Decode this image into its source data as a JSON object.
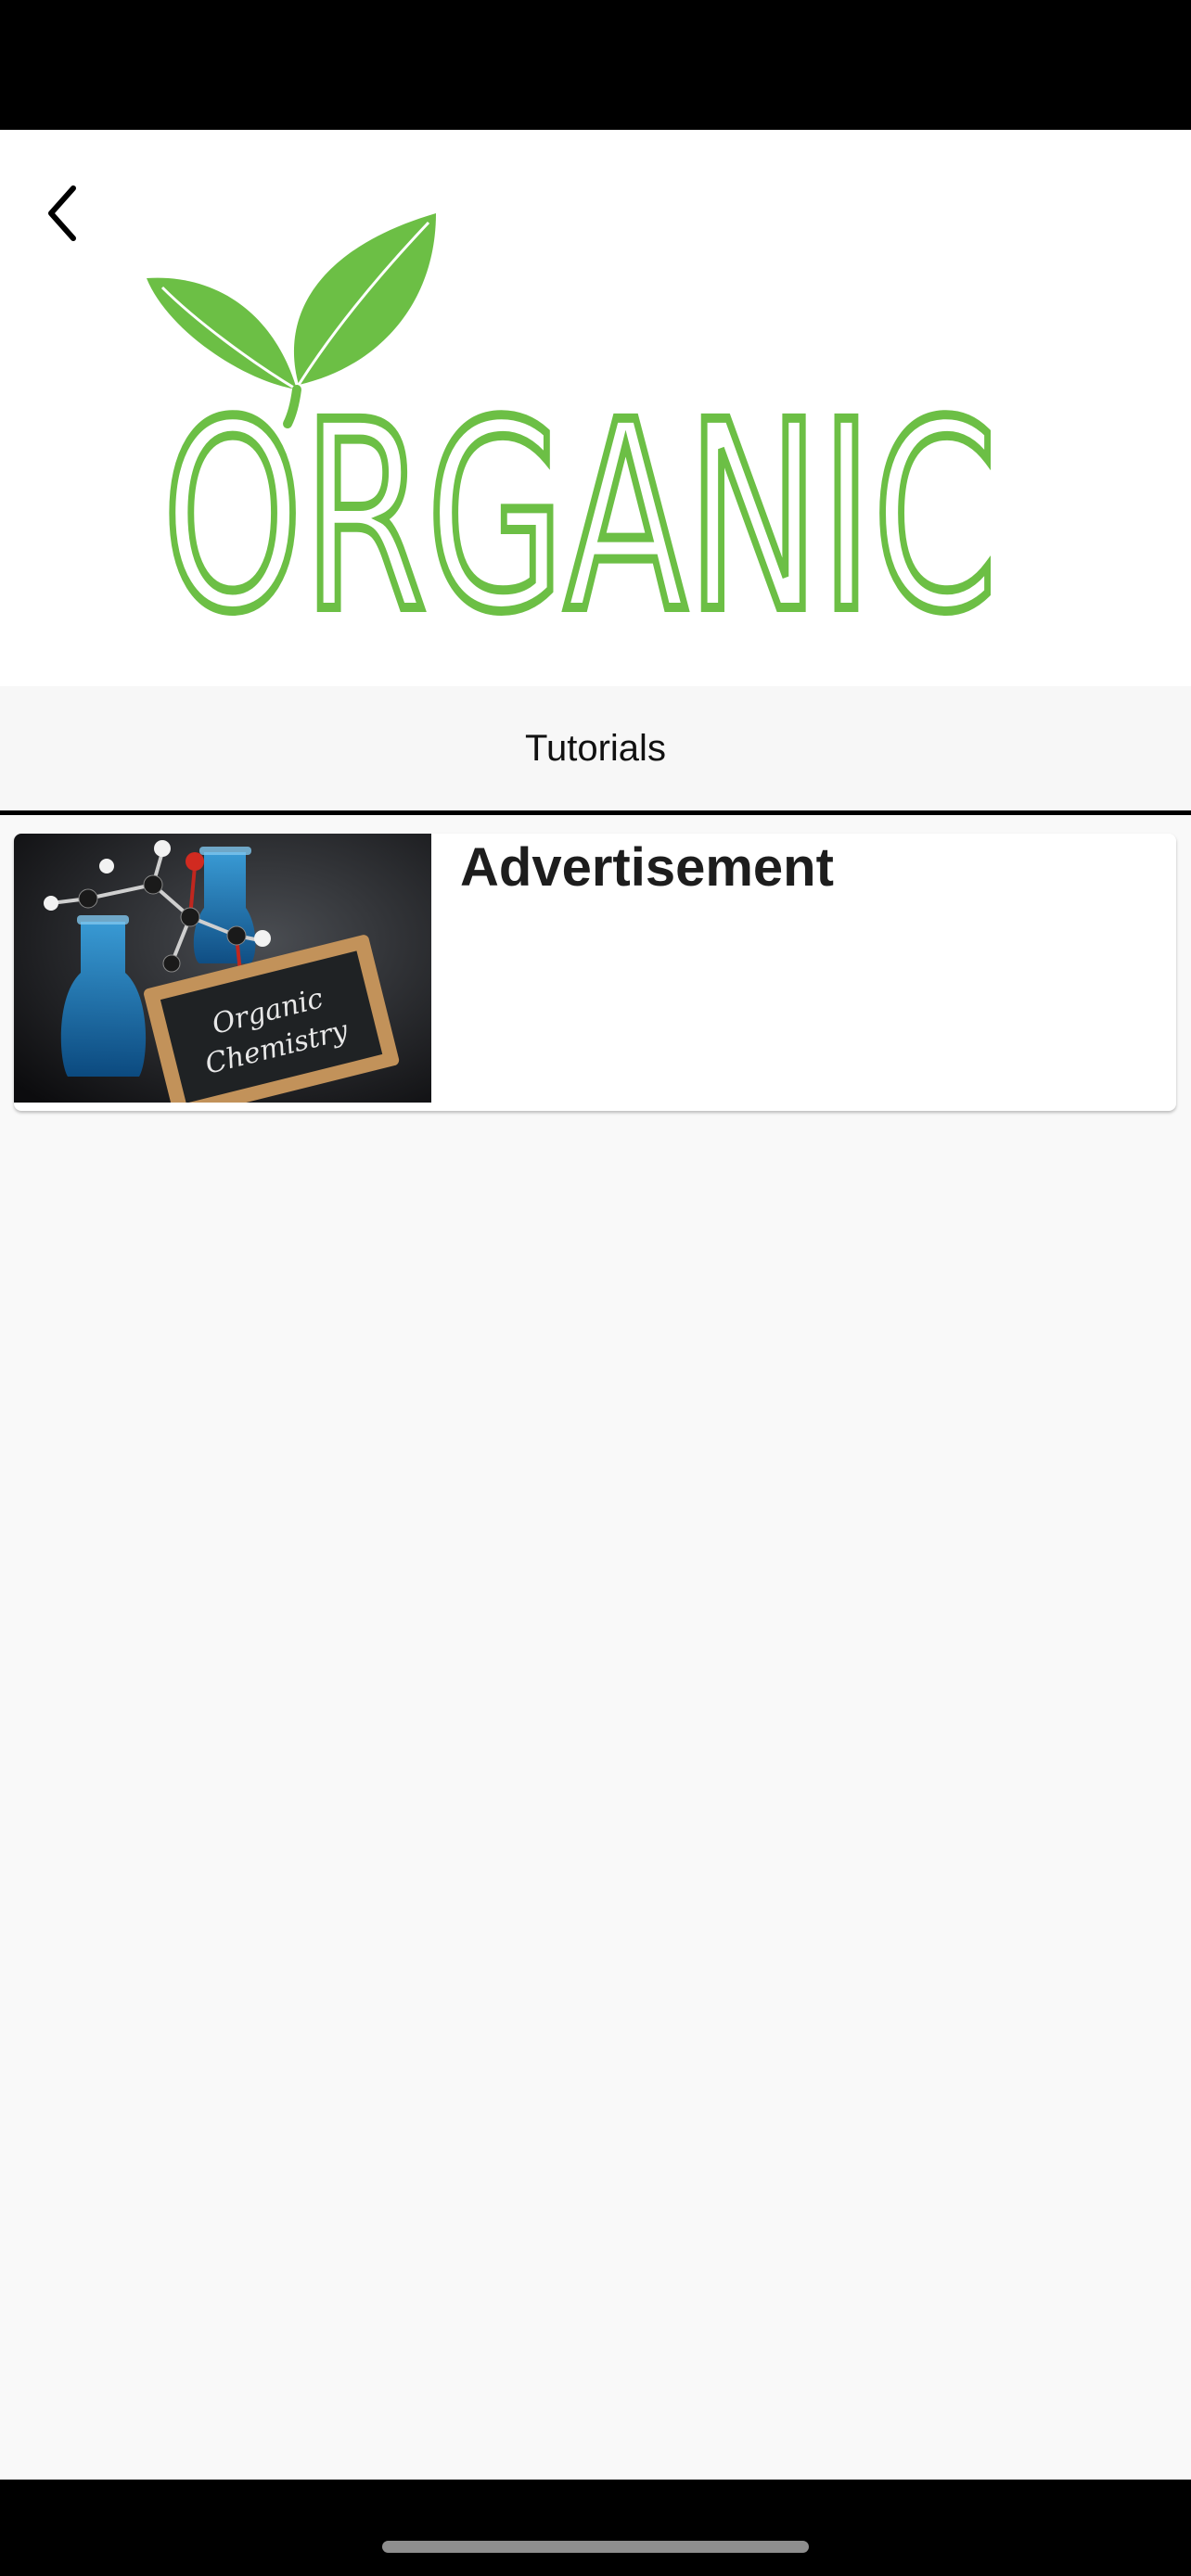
{
  "header": {
    "logo_text": "ORGANIC",
    "logo_color": "#6cbf45"
  },
  "tabs": [
    {
      "label": "Tutorials",
      "active": true
    }
  ],
  "items": [
    {
      "title": "Advertisement",
      "image_caption_line1": "Organic",
      "image_caption_line2": "Chemistry"
    }
  ]
}
